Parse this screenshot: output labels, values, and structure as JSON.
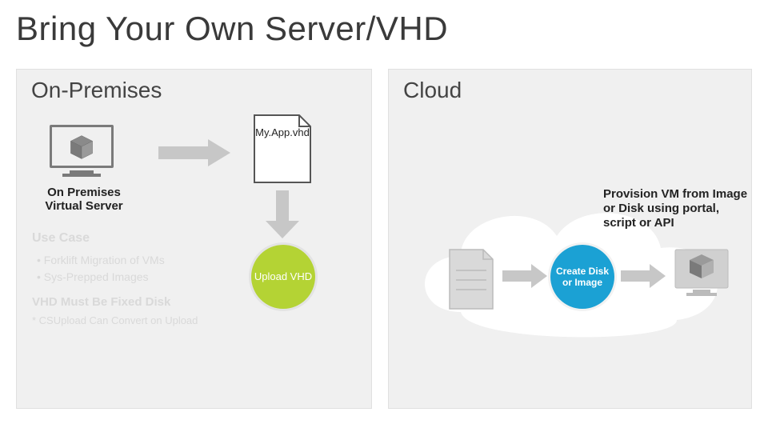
{
  "title": "Bring Your Own Server/VHD",
  "panels": {
    "left": {
      "title": "On-Premises"
    },
    "right": {
      "title": "Cloud"
    }
  },
  "onprem": {
    "server_label": "On Premises Virtual Server",
    "vhd_file_label": "My.App.vhd"
  },
  "usecase": {
    "heading": "Use Case",
    "bullets": [
      "Forklift Migration of VMs",
      "Sys-Prepped Images"
    ],
    "subheading": "VHD Must Be Fixed Disk",
    "note": "* CSUpload Can Convert on Upload"
  },
  "steps": {
    "upload_vhd": "Upload VHD",
    "create_disk_or_image": "Create Disk or Image"
  },
  "provision_text": "Provision VM from Image or Disk using portal, script or API",
  "colors": {
    "upload_circle": "#b4d334",
    "create_circle": "#1ba1d4",
    "panel_bg": "#f0f0f0",
    "arrow": "#c7c7c7",
    "icon_gray": "#7a7a7a",
    "cloud_fill": "#ffffff"
  }
}
